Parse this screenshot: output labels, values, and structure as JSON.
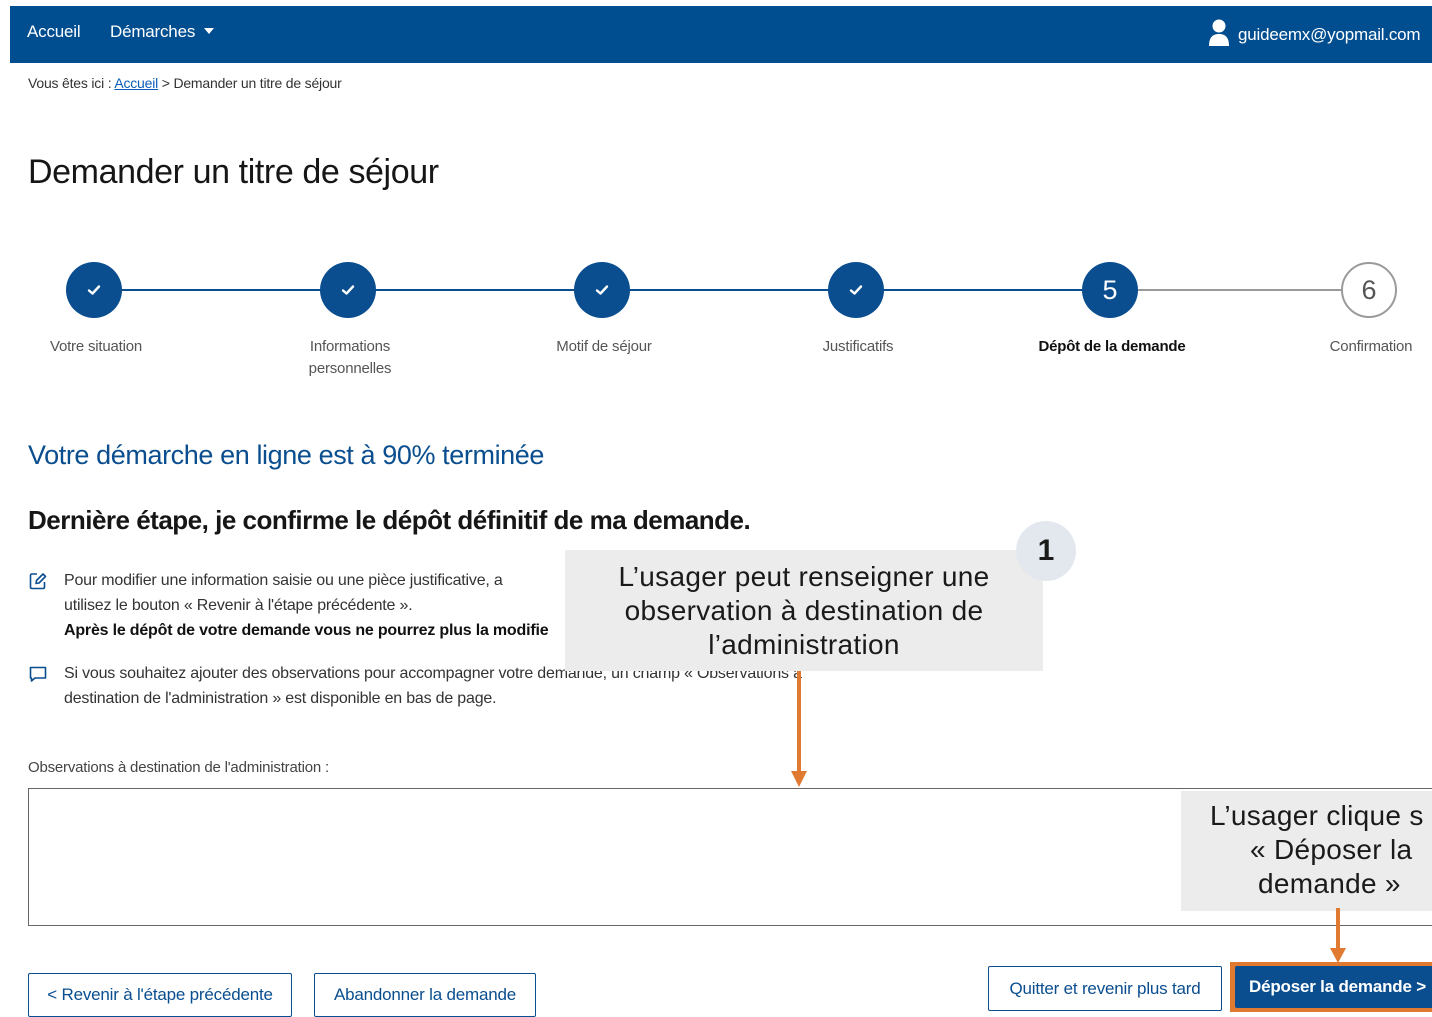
{
  "header": {
    "nav": {
      "home": "Accueil",
      "procedures": "Démarches"
    },
    "user_email": "guideemx@yopmail.com",
    "bar_color": "#004d8f"
  },
  "breadcrumb": {
    "prefix": "Vous êtes ici :",
    "home_link": "Accueil",
    "separator": ">",
    "current": "Demander un titre de séjour"
  },
  "page_title": "Demander un titre de séjour",
  "stepper": {
    "steps": [
      {
        "label": "Votre situation",
        "status": "done"
      },
      {
        "label": "Informations personnelles",
        "status": "done"
      },
      {
        "label": "Motif de séjour",
        "status": "done"
      },
      {
        "label": "Justificatifs",
        "status": "done"
      },
      {
        "label": "Dépôt de la demande",
        "number": "5",
        "status": "current"
      },
      {
        "label": "Confirmation",
        "number": "6",
        "status": "upcoming"
      }
    ]
  },
  "progress_heading": "Votre démarche en ligne est à 90% terminée",
  "last_step_heading": "Dernière étape, je confirme le dépôt définitif de ma demande.",
  "info": {
    "edit_line1": "Pour modifier une information saisie ou une pièce justificative, a",
    "edit_line2": "utilisez le bouton « Revenir à l'étape précédente ».",
    "edit_line3": "Après le dépôt de votre demande vous ne pourrez plus la modifie",
    "obs_line1": "Si vous souhaitez ajouter des observations pour accompagner votre demande, un champ « Observations à",
    "obs_line2": "destination de l'administration » est disponible en bas de page."
  },
  "observations": {
    "label": "Observations à destination de l'administration :",
    "value": ""
  },
  "buttons": {
    "back": "< Revenir à l'étape précédente",
    "abandon": "Abandonner la demande",
    "quit": "Quitter et revenir plus tard",
    "submit": "Déposer la demande >"
  },
  "annotations": {
    "badge_number": "1",
    "callout_1": "L’usager peut renseigner une observation à destination de l’administration",
    "callout_2_line1": "L’usager clique s",
    "callout_2_line2": "« Déposer la",
    "callout_2_line3": "demande »",
    "arrow_color": "#e07a30"
  }
}
